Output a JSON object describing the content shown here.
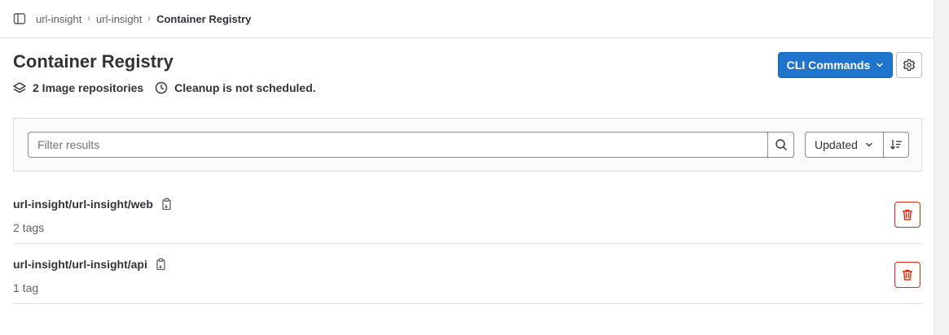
{
  "breadcrumb": {
    "items": [
      "url-insight",
      "url-insight"
    ],
    "current": "Container Registry"
  },
  "page": {
    "title": "Container Registry",
    "repo_count_text": "2 Image repositories",
    "cleanup_text": "Cleanup is not scheduled."
  },
  "actions": {
    "cli_label": "CLI Commands"
  },
  "filter": {
    "placeholder": "Filter results",
    "value": "",
    "sort_label": "Updated"
  },
  "repositories": [
    {
      "name": "url-insight/url-insight/web",
      "tags": "2 tags"
    },
    {
      "name": "url-insight/url-insight/api",
      "tags": "1 tag"
    }
  ],
  "icons": {
    "sidebar_toggle": "sidebar-icon",
    "repos": "layers-icon",
    "cleanup": "clock-icon",
    "cli_chevron": "chevron-down-icon",
    "settings": "gear-icon",
    "search": "search-icon",
    "sort_direction": "sort-lowest-icon",
    "copy": "copy-to-clipboard-icon",
    "delete": "trash-icon"
  },
  "colors": {
    "primary": "#1f75cb",
    "danger": "#dd2b0e",
    "text": "#333238",
    "muted": "#626168",
    "border": "#dcdcde"
  }
}
